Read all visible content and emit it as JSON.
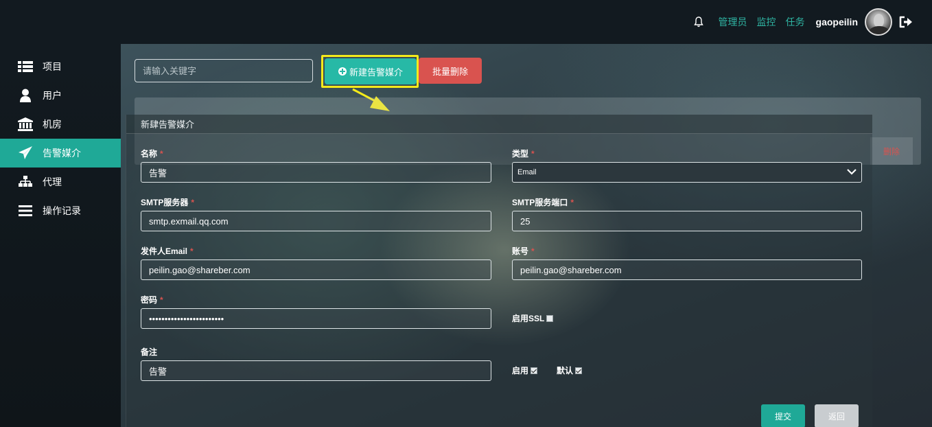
{
  "topbar": {
    "links": [
      "管理员",
      "监控",
      "任务"
    ],
    "username": "gaopeilin",
    "accent_color": "#2fb5a3"
  },
  "sidebar": {
    "items": [
      {
        "label": "项目",
        "icon": "list-icon"
      },
      {
        "label": "用户",
        "icon": "user-icon"
      },
      {
        "label": "机房",
        "icon": "bank-icon"
      },
      {
        "label": "告警媒介",
        "icon": "paper-plane-icon",
        "active": true
      },
      {
        "label": "代理",
        "icon": "sitemap-icon"
      },
      {
        "label": "操作记录",
        "icon": "bars-icon"
      }
    ],
    "active_color": "#1fa997"
  },
  "toolbar": {
    "search_placeholder": "请输入关键字",
    "new_label": "新建告警媒介",
    "batch_delete_label": "批量删除"
  },
  "table": {
    "row_delete_label": "删除"
  },
  "modal": {
    "title": "新肆告警媒介",
    "fields": {
      "name": {
        "label": "名称",
        "value": "告警"
      },
      "type": {
        "label": "类型",
        "value": "Email"
      },
      "smtp_server": {
        "label": "SMTP服务器",
        "value": "smtp.exmail.qq.com"
      },
      "smtp_port": {
        "label": "SMTP服务端口",
        "value": "25"
      },
      "sender": {
        "label": "发件人Email",
        "value": "peilin.gao@shareber.com"
      },
      "account": {
        "label": "账号",
        "value": "peilin.gao@shareber.com"
      },
      "password": {
        "label": "密码",
        "value": "••••••••••••••••••••••••"
      },
      "ssl": {
        "label": "启用SSL",
        "checked": false
      },
      "remark": {
        "label": "备注",
        "value": "告警"
      },
      "enable": {
        "label": "启用",
        "checked": true
      },
      "default": {
        "label": "默认",
        "checked": true
      }
    },
    "submit_label": "提交",
    "back_label": "返回"
  }
}
